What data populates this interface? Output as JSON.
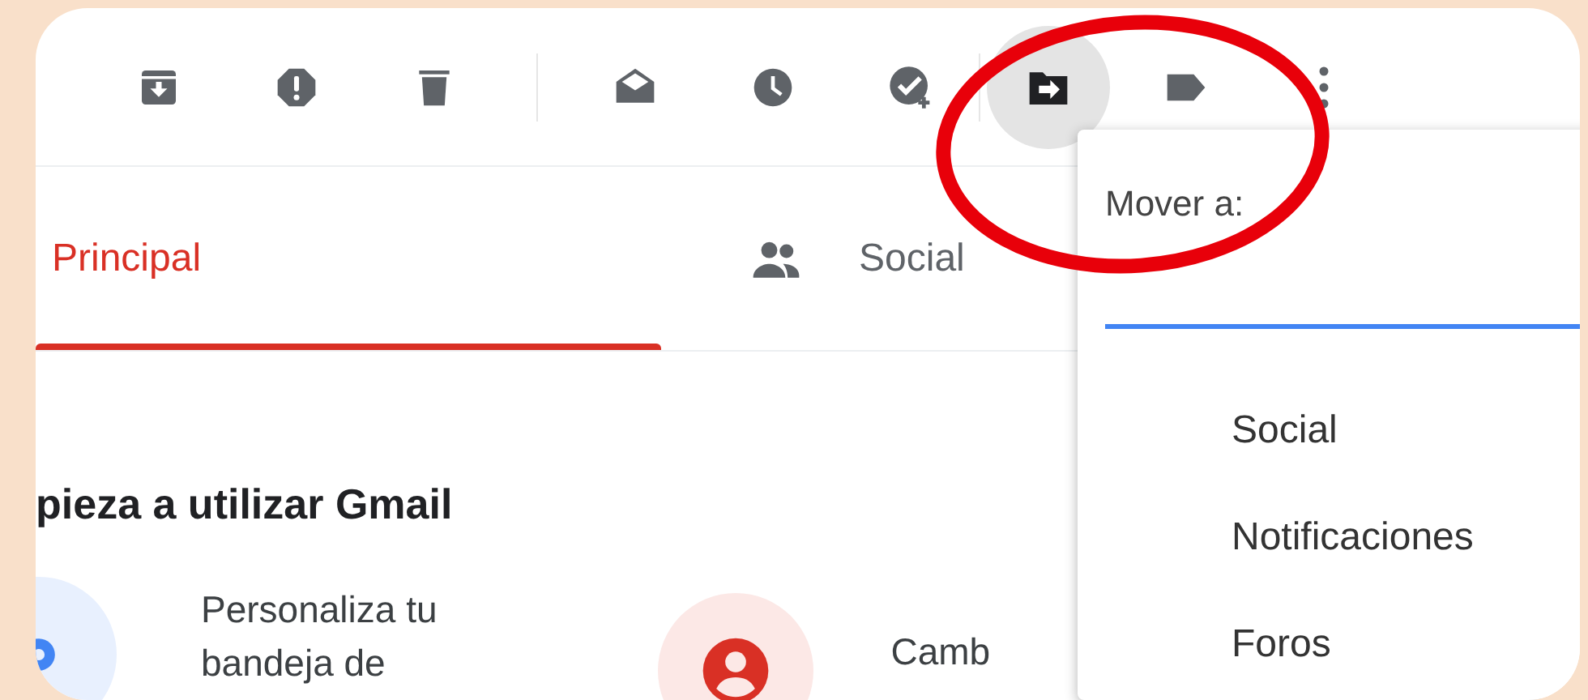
{
  "toolbar": [
    {
      "kind": "archive",
      "selected": false
    },
    {
      "kind": "spam",
      "selected": false
    },
    {
      "kind": "delete",
      "selected": false
    },
    {
      "kind": "divider"
    },
    {
      "kind": "mark-read",
      "selected": false
    },
    {
      "kind": "snooze",
      "selected": false
    },
    {
      "kind": "add-task",
      "selected": false
    },
    {
      "kind": "divider"
    },
    {
      "kind": "move",
      "selected": true
    },
    {
      "kind": "label",
      "selected": false
    },
    {
      "kind": "more",
      "selected": false
    }
  ],
  "tabs": [
    {
      "label": "Principal",
      "kind": "plain",
      "selected": true
    },
    {
      "label": "Social",
      "kind": "people",
      "selected": false
    }
  ],
  "heading": "pieza a utilizar Gmail",
  "cards": [
    {
      "kind": "gear",
      "lines": [
        "Personaliza tu",
        "bandeja de"
      ]
    },
    {
      "kind": "person",
      "lines": [
        "Camb"
      ]
    }
  ],
  "move_menu": {
    "title": "Mover a:",
    "items": [
      "Social",
      "Notificaciones",
      "Foros"
    ]
  },
  "annotation": {
    "kind": "ellipse"
  }
}
